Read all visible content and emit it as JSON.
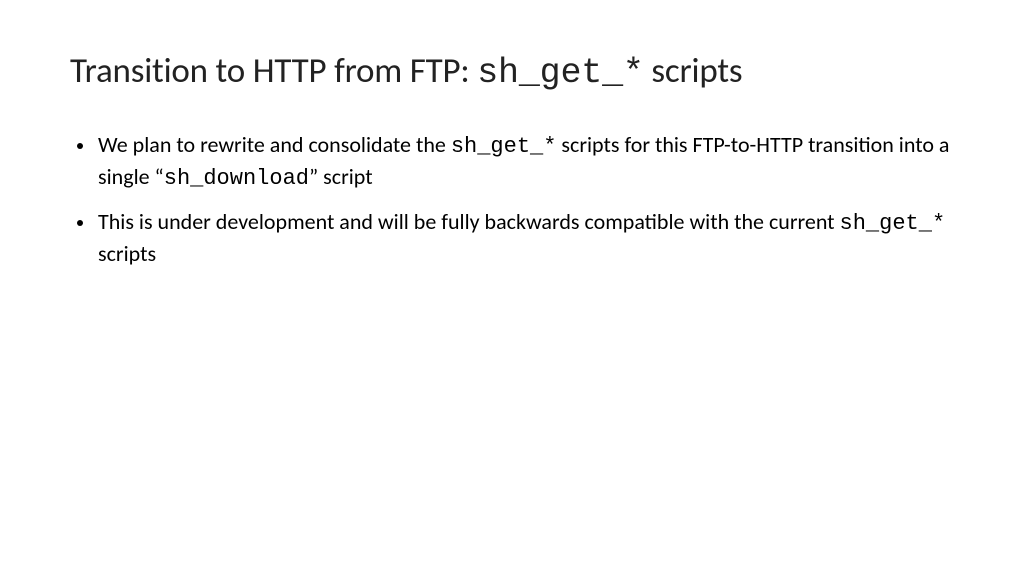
{
  "title": {
    "pre": "Transition to HTTP from FTP: ",
    "code": "sh_get_*",
    "post": " scripts"
  },
  "bullets": [
    {
      "pre": "We plan to rewrite and consolidate the ",
      "code1": "sh_get_*",
      "mid": " scripts for this FTP-to-HTTP transition into a single “",
      "code2": "sh_download",
      "post": "” script"
    },
    {
      "pre": "This is under development and will be fully backwards compatible with the current ",
      "code1": "sh_get_*",
      "mid": " scripts",
      "code2": "",
      "post": ""
    }
  ]
}
